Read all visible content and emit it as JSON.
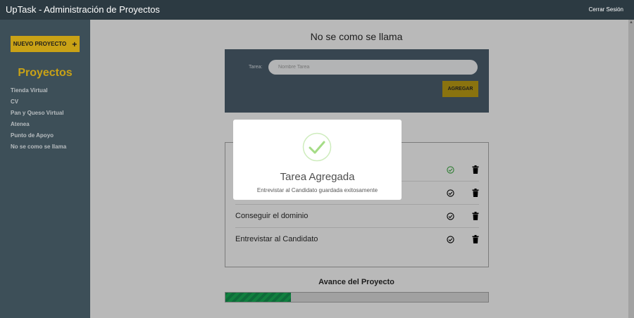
{
  "header": {
    "app_title": "UpTask - Administración de Proyectos",
    "logout_label": "Cerrar Sesión"
  },
  "sidebar": {
    "new_project_label": "NUEVO PROYECTO",
    "heading": "Proyectos",
    "projects": [
      "Tienda Virtual",
      "CV",
      "Pan y Queso Virtual",
      "Atenea",
      "Punto de Apoyo",
      "No se como se llama"
    ]
  },
  "main": {
    "project_title": "No se como se llama",
    "form": {
      "label": "Tarea:",
      "placeholder": "Nombre Tarea",
      "button_label": "AGREGAR"
    },
    "tasks": [
      {
        "name": "",
        "completed": true
      },
      {
        "name": "",
        "completed": false
      },
      {
        "name": "Conseguir el dominio",
        "completed": false
      },
      {
        "name": "Entrevistar al Candidato",
        "completed": false
      }
    ],
    "progress": {
      "title": "Avance del Proyecto",
      "fraction": 0.25
    }
  },
  "modal": {
    "title": "Tarea Agregada",
    "text": "Entrevistar al Candidato guardada exitosamente",
    "icon": "success-check-icon"
  },
  "colors": {
    "accent": "#c9a216",
    "sidebar_bg": "#3d4f58",
    "header_bg": "#2c3a42",
    "progress_green": "#11803f",
    "success_green": "#a5dc86",
    "completed_check": "#2e7d32"
  }
}
